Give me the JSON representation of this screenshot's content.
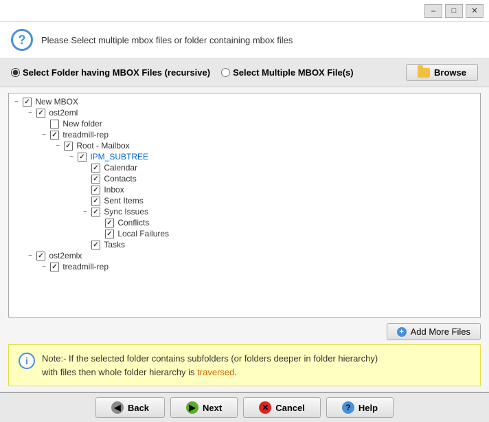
{
  "titlebar": {
    "minimize_label": "–",
    "maximize_label": "□",
    "close_label": "✕"
  },
  "header": {
    "text": "Please Select multiple mbox files or folder containing mbox files"
  },
  "radio": {
    "option1_label": "Select Folder having MBOX Files (recursive)",
    "option2_label": "Select Multiple MBOX File(s)",
    "browse_label": "Browse"
  },
  "tree": {
    "nodes": [
      {
        "id": "new-mbox",
        "label": "New MBOX",
        "indent": 0,
        "expanded": true,
        "checked": true
      },
      {
        "id": "ost2eml",
        "label": "ost2eml",
        "indent": 1,
        "expanded": true,
        "checked": true
      },
      {
        "id": "new-folder",
        "label": "New folder",
        "indent": 2,
        "expanded": false,
        "checked": false,
        "no_expand": true
      },
      {
        "id": "treadmill-rep",
        "label": "treadmill-rep",
        "indent": 2,
        "expanded": true,
        "checked": true
      },
      {
        "id": "root-mailbox",
        "label": "Root - Mailbox",
        "indent": 3,
        "expanded": true,
        "checked": true
      },
      {
        "id": "ipm-subtree",
        "label": "IPM_SUBTREE",
        "indent": 4,
        "expanded": true,
        "checked": true,
        "blue": true
      },
      {
        "id": "calendar",
        "label": "Calendar",
        "indent": 5,
        "expanded": false,
        "checked": true,
        "no_expand": true
      },
      {
        "id": "contacts",
        "label": "Contacts",
        "indent": 5,
        "expanded": false,
        "checked": true,
        "no_expand": true
      },
      {
        "id": "inbox",
        "label": "Inbox",
        "indent": 5,
        "expanded": false,
        "checked": true,
        "no_expand": true
      },
      {
        "id": "sent-items",
        "label": "Sent Items",
        "indent": 5,
        "expanded": false,
        "checked": true,
        "no_expand": true
      },
      {
        "id": "sync-issues",
        "label": "Sync Issues",
        "indent": 5,
        "expanded": true,
        "checked": true
      },
      {
        "id": "conflicts",
        "label": "Conflicts",
        "indent": 6,
        "expanded": false,
        "checked": true,
        "no_expand": true
      },
      {
        "id": "local-failures",
        "label": "Local Failures",
        "indent": 6,
        "expanded": false,
        "checked": true,
        "no_expand": true
      },
      {
        "id": "tasks",
        "label": "Tasks",
        "indent": 5,
        "expanded": false,
        "checked": true,
        "no_expand": true
      },
      {
        "id": "ost2emlx",
        "label": "ost2emlx",
        "indent": 1,
        "expanded": true,
        "checked": true
      },
      {
        "id": "treadmill-rep2",
        "label": "treadmill-rep",
        "indent": 2,
        "expanded": true,
        "checked": true
      }
    ]
  },
  "add_files_btn": {
    "label": "Add More Files"
  },
  "note": {
    "text_line1": "Note:- If the selected folder contains subfolders (or folders deeper in folder hierarchy)",
    "text_line2": "with files then whole folder hierarchy is traversed.",
    "highlight_word": "traversed"
  },
  "buttons": {
    "back_label": "Back",
    "next_label": "Next",
    "cancel_label": "Cancel",
    "help_label": "Help"
  }
}
